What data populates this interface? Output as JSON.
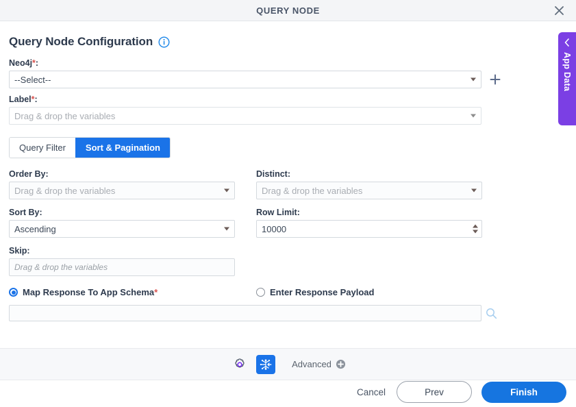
{
  "titlebar": {
    "title": "QUERY NODE",
    "close_icon": "close-icon"
  },
  "heading": {
    "title": "Query Node Configuration",
    "info_icon": "info-icon"
  },
  "form": {
    "neo4j": {
      "label": "Neo4j",
      "required": "*",
      "suffix": ":",
      "value": "--Select--",
      "add_icon": "plus-icon"
    },
    "label_field": {
      "label": "Label",
      "required": "*",
      "suffix": ":",
      "placeholder": "Drag & drop the variables"
    },
    "order_by": {
      "label": "Order By:",
      "placeholder": "Drag & drop the variables"
    },
    "distinct": {
      "label": "Distinct:",
      "placeholder": "Drag & drop the variables"
    },
    "sort_by": {
      "label": "Sort By:",
      "value": "Ascending"
    },
    "row_limit": {
      "label": "Row Limit:",
      "value": "10000"
    },
    "skip": {
      "label": "Skip:",
      "placeholder": "Drag & drop the variables"
    }
  },
  "tabs": [
    {
      "label": "Query Filter",
      "active": false
    },
    {
      "label": "Sort & Pagination",
      "active": true
    }
  ],
  "response": {
    "map_option": {
      "label": "Map Response To App Schema",
      "required": "*",
      "selected": true
    },
    "payload_option": {
      "label": "Enter Response Payload",
      "selected": false
    },
    "schema_value": "",
    "search_icon": "search-icon"
  },
  "app_data_tab": {
    "label": "App Data",
    "chevron_icon": "chevron-left-icon",
    "color": "#7b3fe4"
  },
  "toolbar": {
    "settings_icon": "gear-icon",
    "schema_map_icon": "node-mapping-icon",
    "advanced_label": "Advanced",
    "advanced_add_icon": "plus-circle-icon"
  },
  "footer": {
    "cancel": "Cancel",
    "prev": "Prev",
    "finish": "Finish"
  },
  "colors": {
    "accent": "#1a73e8",
    "purple": "#7b3fe4",
    "required": "#d9534f"
  }
}
